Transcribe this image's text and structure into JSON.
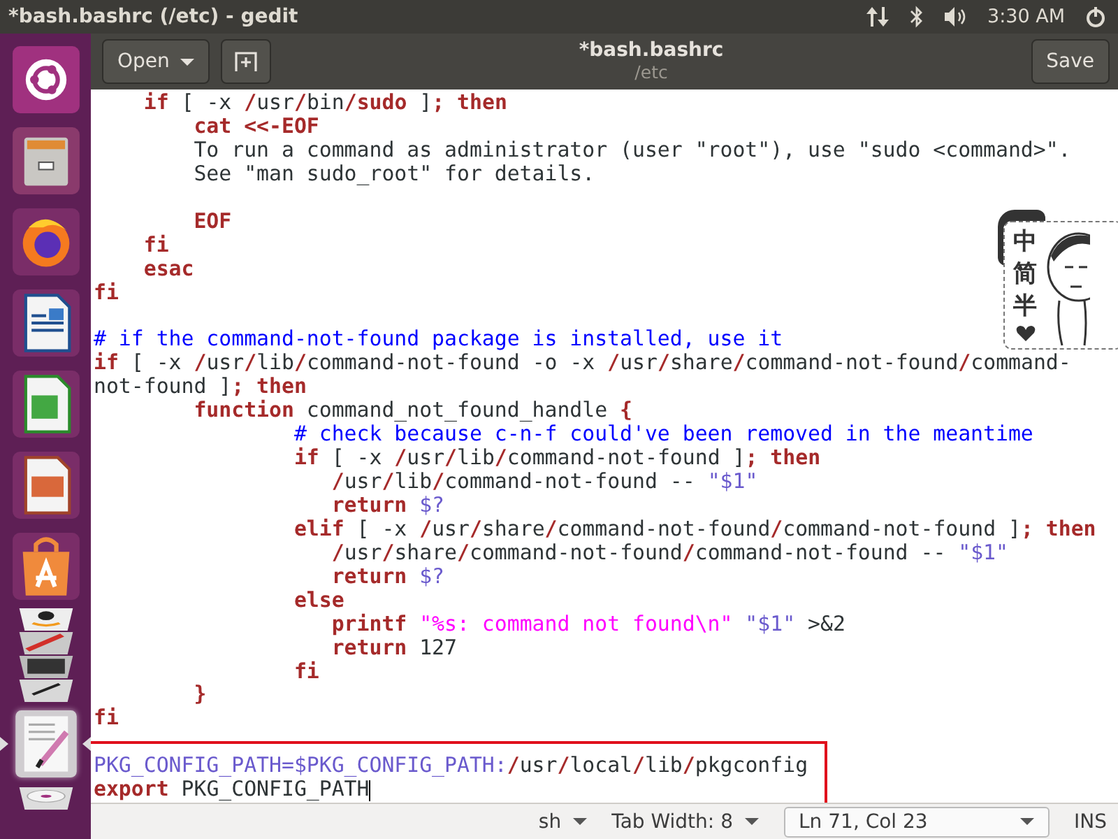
{
  "top_bar": {
    "title": "*bash.bashrc (/etc) - gedit",
    "clock": "3:30 AM"
  },
  "dock": {
    "items": [
      {
        "kind": "ubuntu",
        "active": false
      },
      {
        "kind": "files",
        "active": false
      },
      {
        "kind": "firefox",
        "active": false
      },
      {
        "kind": "writer",
        "active": false
      },
      {
        "kind": "calc",
        "active": false
      },
      {
        "kind": "impress",
        "active": false
      },
      {
        "kind": "software",
        "active": false
      },
      {
        "kind": "amazon",
        "active": false
      },
      {
        "kind": "settings",
        "active": false
      },
      {
        "kind": "terminal",
        "active": false
      },
      {
        "kind": "editor",
        "active": false
      },
      {
        "kind": "gedit",
        "active": true
      },
      {
        "kind": "disc",
        "active": false
      }
    ]
  },
  "header": {
    "open_button": "Open",
    "title": "*bash.bashrc",
    "subtitle": "/etc",
    "save_button": "Save"
  },
  "editor": {
    "lines": [
      {
        "kind": "code",
        "tokens": [
          {
            "kind": "keyword",
            "text": "    if"
          },
          {
            "kind": "plain",
            "text": " [ -x "
          },
          {
            "kind": "sep",
            "text": "/"
          },
          {
            "kind": "plain",
            "text": "usr"
          },
          {
            "kind": "sep",
            "text": "/"
          },
          {
            "kind": "plain",
            "text": "bin"
          },
          {
            "kind": "sep",
            "text": "/"
          },
          {
            "kind": "keyword",
            "text": "sudo"
          },
          {
            "kind": "plain",
            "text": " ]"
          },
          {
            "kind": "sep",
            "text": ";"
          },
          {
            "kind": "keyword",
            "text": " then"
          }
        ]
      },
      {
        "kind": "code",
        "tokens": [
          {
            "kind": "keyword",
            "text": "        cat <<-EOF"
          }
        ]
      },
      {
        "kind": "code",
        "tokens": [
          {
            "kind": "plain",
            "text": "        To run a command as administrator (user \"root\"), use \"sudo <command>\"."
          }
        ]
      },
      {
        "kind": "code",
        "tokens": [
          {
            "kind": "plain",
            "text": "        See \"man sudo_root\" for details."
          }
        ]
      },
      {
        "kind": "blank"
      },
      {
        "kind": "code",
        "tokens": [
          {
            "kind": "keyword",
            "text": "        EOF"
          }
        ]
      },
      {
        "kind": "code",
        "tokens": [
          {
            "kind": "keyword",
            "text": "    fi"
          }
        ]
      },
      {
        "kind": "code",
        "tokens": [
          {
            "kind": "keyword",
            "text": "    esac"
          }
        ]
      },
      {
        "kind": "code",
        "tokens": [
          {
            "kind": "keyword",
            "text": "fi"
          }
        ]
      },
      {
        "kind": "blank"
      },
      {
        "kind": "code",
        "tokens": [
          {
            "kind": "comment",
            "text": "# if the command-not-found package is installed, use it"
          }
        ]
      },
      {
        "kind": "code",
        "tokens": [
          {
            "kind": "keyword",
            "text": "if"
          },
          {
            "kind": "plain",
            "text": " [ -x "
          },
          {
            "kind": "sep",
            "text": "/"
          },
          {
            "kind": "plain",
            "text": "usr"
          },
          {
            "kind": "sep",
            "text": "/"
          },
          {
            "kind": "plain",
            "text": "lib"
          },
          {
            "kind": "sep",
            "text": "/"
          },
          {
            "kind": "plain",
            "text": "command-not-found -o -x "
          },
          {
            "kind": "sep",
            "text": "/"
          },
          {
            "kind": "plain",
            "text": "usr"
          },
          {
            "kind": "sep",
            "text": "/"
          },
          {
            "kind": "plain",
            "text": "share"
          },
          {
            "kind": "sep",
            "text": "/"
          },
          {
            "kind": "plain",
            "text": "command-not-found"
          },
          {
            "kind": "sep",
            "text": "/"
          },
          {
            "kind": "plain",
            "text": "command-"
          }
        ]
      },
      {
        "kind": "code",
        "tokens": [
          {
            "kind": "plain",
            "text": "not-found ]"
          },
          {
            "kind": "sep",
            "text": ";"
          },
          {
            "kind": "keyword",
            "text": " then"
          }
        ]
      },
      {
        "kind": "code",
        "tokens": [
          {
            "kind": "keyword",
            "text": "        function"
          },
          {
            "kind": "plain",
            "text": " command_not_found_handle "
          },
          {
            "kind": "sep",
            "text": "{"
          }
        ]
      },
      {
        "kind": "code",
        "tokens": [
          {
            "kind": "comment",
            "text": "                # check because c-n-f could've been removed in the meantime"
          }
        ]
      },
      {
        "kind": "code",
        "tokens": [
          {
            "kind": "keyword",
            "text": "                if"
          },
          {
            "kind": "plain",
            "text": " [ -x "
          },
          {
            "kind": "sep",
            "text": "/"
          },
          {
            "kind": "plain",
            "text": "usr"
          },
          {
            "kind": "sep",
            "text": "/"
          },
          {
            "kind": "plain",
            "text": "lib"
          },
          {
            "kind": "sep",
            "text": "/"
          },
          {
            "kind": "plain",
            "text": "command-not-found ]"
          },
          {
            "kind": "sep",
            "text": ";"
          },
          {
            "kind": "keyword",
            "text": " then"
          }
        ]
      },
      {
        "kind": "code",
        "tokens": [
          {
            "kind": "sep",
            "text": "                   /"
          },
          {
            "kind": "plain",
            "text": "usr"
          },
          {
            "kind": "sep",
            "text": "/"
          },
          {
            "kind": "plain",
            "text": "lib"
          },
          {
            "kind": "sep",
            "text": "/"
          },
          {
            "kind": "plain",
            "text": "command-not-found -- "
          },
          {
            "kind": "var",
            "text": "\"$1\""
          }
        ]
      },
      {
        "kind": "code",
        "tokens": [
          {
            "kind": "keyword",
            "text": "                   return "
          },
          {
            "kind": "var",
            "text": "$?"
          }
        ]
      },
      {
        "kind": "code",
        "tokens": [
          {
            "kind": "keyword",
            "text": "                elif"
          },
          {
            "kind": "plain",
            "text": " [ -x "
          },
          {
            "kind": "sep",
            "text": "/"
          },
          {
            "kind": "plain",
            "text": "usr"
          },
          {
            "kind": "sep",
            "text": "/"
          },
          {
            "kind": "plain",
            "text": "share"
          },
          {
            "kind": "sep",
            "text": "/"
          },
          {
            "kind": "plain",
            "text": "command-not-found"
          },
          {
            "kind": "sep",
            "text": "/"
          },
          {
            "kind": "plain",
            "text": "command-not-found ]"
          },
          {
            "kind": "sep",
            "text": ";"
          },
          {
            "kind": "keyword",
            "text": " then"
          }
        ]
      },
      {
        "kind": "code",
        "tokens": [
          {
            "kind": "sep",
            "text": "                   /"
          },
          {
            "kind": "plain",
            "text": "usr"
          },
          {
            "kind": "sep",
            "text": "/"
          },
          {
            "kind": "plain",
            "text": "share"
          },
          {
            "kind": "sep",
            "text": "/"
          },
          {
            "kind": "plain",
            "text": "command-not-found"
          },
          {
            "kind": "sep",
            "text": "/"
          },
          {
            "kind": "plain",
            "text": "command-not-found -- "
          },
          {
            "kind": "var",
            "text": "\"$1\""
          }
        ]
      },
      {
        "kind": "code",
        "tokens": [
          {
            "kind": "keyword",
            "text": "                   return "
          },
          {
            "kind": "var",
            "text": "$?"
          }
        ]
      },
      {
        "kind": "code",
        "tokens": [
          {
            "kind": "keyword",
            "text": "                else"
          }
        ]
      },
      {
        "kind": "code",
        "tokens": [
          {
            "kind": "keyword",
            "text": "                   printf "
          },
          {
            "kind": "string",
            "text": "\"%s: command not found\\n\""
          },
          {
            "kind": "var",
            "text": " \"$1\""
          },
          {
            "kind": "plain",
            "text": " >&2"
          }
        ]
      },
      {
        "kind": "code",
        "tokens": [
          {
            "kind": "keyword",
            "text": "                   return"
          },
          {
            "kind": "plain",
            "text": " 127"
          }
        ]
      },
      {
        "kind": "code",
        "tokens": [
          {
            "kind": "keyword",
            "text": "                fi"
          }
        ]
      },
      {
        "kind": "code",
        "tokens": [
          {
            "kind": "keyword",
            "text": "        }"
          }
        ]
      },
      {
        "kind": "code",
        "tokens": [
          {
            "kind": "keyword",
            "text": "fi"
          }
        ]
      },
      {
        "kind": "blank"
      },
      {
        "kind": "code",
        "tokens": [
          {
            "kind": "var",
            "text": "PKG_CONFIG_PATH=$PKG_CONFIG_PATH:"
          },
          {
            "kind": "sep",
            "text": "/"
          },
          {
            "kind": "plain",
            "text": "usr"
          },
          {
            "kind": "sep",
            "text": "/"
          },
          {
            "kind": "plain",
            "text": "local"
          },
          {
            "kind": "sep",
            "text": "/"
          },
          {
            "kind": "plain",
            "text": "lib"
          },
          {
            "kind": "sep",
            "text": "/"
          },
          {
            "kind": "plain",
            "text": "pkgconfig"
          }
        ]
      },
      {
        "kind": "code",
        "cursor": true,
        "tokens": [
          {
            "kind": "keyword",
            "text": "export"
          },
          {
            "kind": "plain",
            "text": " PKG_CONFIG_PATH"
          }
        ]
      }
    ]
  },
  "ime_widget": {
    "labels": [
      "中",
      "简",
      "半"
    ]
  },
  "status_bar": {
    "language": "sh",
    "tab_width": "Tab Width: 8",
    "position": "Ln 71, Col 23",
    "mode": "INS"
  }
}
